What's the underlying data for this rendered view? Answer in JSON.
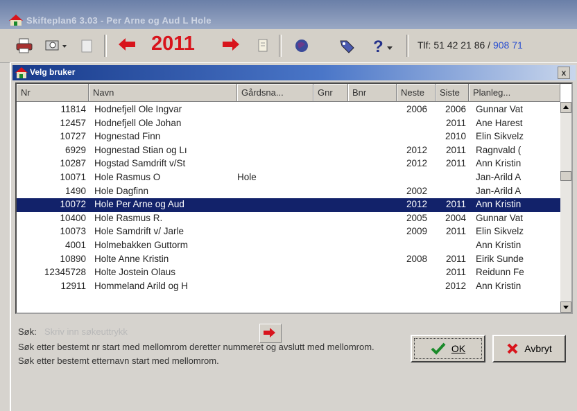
{
  "window": {
    "title": "Skifteplan6 3.03 - Per Arne og Aud L Hole"
  },
  "toolbar": {
    "year": "2011",
    "phone_label": "Tlf: 51 42 21 86 / ",
    "phone_mobile": "908 71"
  },
  "dialog": {
    "title": "Velg bruker",
    "close_label": "x",
    "columns": [
      "Nr",
      "Navn",
      "Gårdsna...",
      "Gnr",
      "Bnr",
      "Neste",
      "Siste",
      "Planleg..."
    ],
    "rows": [
      {
        "nr": "11814",
        "navn": "Hodnefjell Ole Ingvar",
        "gard": "",
        "neste": "2006",
        "siste": "2006",
        "plan": "Gunnar Vat"
      },
      {
        "nr": "12457",
        "navn": "Hodnefjell Ole Johan",
        "gard": "",
        "neste": "",
        "siste": "2011",
        "plan": "Ane Harest"
      },
      {
        "nr": "10727",
        "navn": "Hognestad Finn",
        "gard": "",
        "neste": "",
        "siste": "2010",
        "plan": "Elin Sikvelz"
      },
      {
        "nr": "6929",
        "navn": "Hognestad Stian og Lı",
        "gard": "",
        "neste": "2012",
        "siste": "2011",
        "plan": "Ragnvald ("
      },
      {
        "nr": "10287",
        "navn": "Hogstad Samdrift v/St",
        "gard": "",
        "neste": "2012",
        "siste": "2011",
        "plan": "Ann Kristin"
      },
      {
        "nr": "10071",
        "navn": "Hole Rasmus O",
        "gard": "Hole",
        "neste": "",
        "siste": "",
        "plan": "Jan-Arild A"
      },
      {
        "nr": "1490",
        "navn": "Hole Dagfinn",
        "gard": "",
        "neste": "2002",
        "siste": "",
        "plan": "Jan-Arild A"
      },
      {
        "nr": "10072",
        "navn": "Hole Per Arne og Aud",
        "gard": "",
        "neste": "2012",
        "siste": "2011",
        "plan": "Ann Kristin"
      },
      {
        "nr": "10400",
        "navn": "Hole Rasmus R.",
        "gard": "",
        "neste": "2005",
        "siste": "2004",
        "plan": "Gunnar Vat"
      },
      {
        "nr": "10073",
        "navn": "Hole Samdrift v/ Jarle",
        "gard": "",
        "neste": "2009",
        "siste": "2011",
        "plan": "Elin Sikvelz"
      },
      {
        "nr": "4001",
        "navn": "Holmebakken Guttorm",
        "gard": "",
        "neste": "",
        "siste": "",
        "plan": "Ann Kristin"
      },
      {
        "nr": "10890",
        "navn": "Holte Anne Kristin",
        "gard": "",
        "neste": "2008",
        "siste": "2011",
        "plan": "Eirik Sunde"
      },
      {
        "nr": "12345728",
        "navn": "Holte Jostein Olaus",
        "gard": "",
        "neste": "",
        "siste": "2011",
        "plan": "Reidunn Fe"
      },
      {
        "nr": "12911",
        "navn": "Hommeland Arild og H",
        "gard": "",
        "neste": "",
        "siste": "2012",
        "plan": "Ann Kristin"
      }
    ],
    "selected_index": 7,
    "search": {
      "label": "Søk:",
      "value": "Skriv inn søkeuttrykk",
      "help": "Søk etter bestemt nr start med mellomrom deretter nummeret og avslutt med mellomrom. Søk etter bestemt etternavn start med mellomrom."
    },
    "ok_label": "OK",
    "cancel_label": "Avbryt"
  },
  "colors": {
    "selected_row": "#12226a",
    "year_red": "#d8141c",
    "mobile_blue": "#2a4fd0"
  }
}
